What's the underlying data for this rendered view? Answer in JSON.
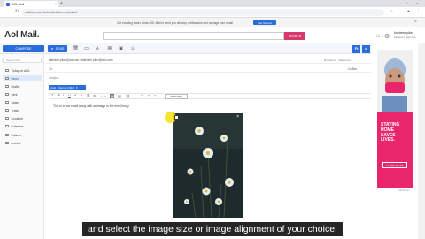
{
  "browser": {
    "tab_title": "AOL Mail",
    "tab_close": "×",
    "new_tab": "+",
    "window_controls": [
      "–",
      "□",
      "×"
    ],
    "nav": [
      "←",
      "→",
      "↻"
    ],
    "url": "mail.aol.com/webmail-std/en-us/suite#"
  },
  "notification": {
    "text": "Get emailing faster. Allow AOL Mail to send you desktop notifications and manage your email.",
    "button": "Get Started",
    "close": "×"
  },
  "header": {
    "logo": "Aol Mail.",
    "search_button": "SEARCH",
    "user_name": "kathleen piker",
    "user_sub": "Options  |  Sign Out"
  },
  "toolbar": {
    "compose": "COMPOSE",
    "send": "SEND",
    "icons": [
      "trash-icon",
      "save-draft-icon",
      "spellcheck-icon",
      "attach-icon",
      "image-icon",
      "emoji-icon"
    ],
    "popout": "⧉",
    "close": "✕"
  },
  "sidebar": {
    "search_placeholder": "Search Mail",
    "items": [
      {
        "label": "Today on AOL",
        "active": false
      },
      {
        "label": "Inbox",
        "active": true
      },
      {
        "label": "Drafts",
        "active": false
      },
      {
        "label": "Sent",
        "active": false
      },
      {
        "label": "Spam",
        "active": false
      },
      {
        "label": "Trash",
        "active": false
      },
      {
        "label": "Contacts",
        "active": false
      },
      {
        "label": "Calendar",
        "active": false
      },
      {
        "label": "Folders",
        "active": false
      },
      {
        "label": "Archive",
        "active": false
      }
    ]
  },
  "compose": {
    "from": "kathleen.piker@aol.com <kathleen.piker@aol.com>",
    "emoticons": "Emoticons  ·  Stationery",
    "to_label": "To:",
    "cc_bcc": "Cc  Bcc",
    "subject_label": "Subject",
    "font_select": "Arial · Normal (10pt)",
    "dictionary": "Dictionary",
    "body": "This is a test email along with an image in the email body."
  },
  "image": {
    "close": "×"
  },
  "ad": {
    "headline": "STAYING HOME SAVES LIVES.",
    "cta": "LEARN MORE",
    "adchoices": "AdChoices"
  },
  "caption": "and select the image size or image alignment of your choice.",
  "colors": {
    "accent": "#2b6dd8",
    "search_button": "#d63a6b",
    "ad_bg": "#e9266b"
  }
}
